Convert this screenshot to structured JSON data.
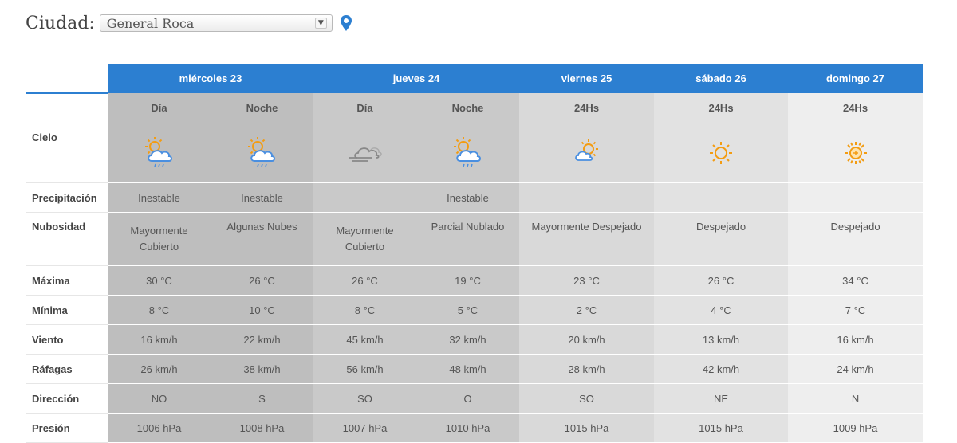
{
  "city": {
    "label": "Ciudad:",
    "selected": "General Roca"
  },
  "days": [
    {
      "label": "miércoles 23"
    },
    {
      "label": "jueves 24"
    },
    {
      "label": "viernes 25"
    },
    {
      "label": "sábado 26"
    },
    {
      "label": "domingo 27"
    }
  ],
  "periods": [
    "Día",
    "Noche",
    "Día",
    "Noche",
    "24Hs",
    "24Hs",
    "24Hs"
  ],
  "rows": {
    "cielo": "Cielo",
    "precipitacion": "Precipitación",
    "nubosidad": "Nubosidad",
    "maxima": "Máxima",
    "minima": "Mínima",
    "viento": "Viento",
    "rafagas": "Ráfagas",
    "direccion": "Dirección",
    "presion": "Presión"
  },
  "sky_icons": [
    "sun-cloud-rain-icon",
    "sun-cloud-rain-icon",
    "cloud-wind-icon",
    "sun-cloud-rain-icon",
    "sun-cloud-icon",
    "sun-icon",
    "hot-sun-icon"
  ],
  "precipitacion": [
    "Inestable",
    "Inestable",
    "",
    "Inestable",
    "",
    "",
    ""
  ],
  "nubosidad": [
    [
      "Mayormente",
      "Cubierto"
    ],
    [
      "Algunas Nubes",
      ""
    ],
    [
      "Mayormente",
      "Cubierto"
    ],
    [
      "Parcial Nublado",
      ""
    ],
    [
      "Mayormente Despejado",
      ""
    ],
    [
      "Despejado",
      ""
    ],
    [
      "Despejado",
      ""
    ]
  ],
  "maxima": [
    "30 °C",
    "26 °C",
    "26 °C",
    "19 °C",
    "23 °C",
    "26 °C",
    "34 °C"
  ],
  "minima": [
    "8 °C",
    "10 °C",
    "8 °C",
    "5 °C",
    "2 °C",
    "4 °C",
    "7 °C"
  ],
  "viento": [
    "16 km/h",
    "22 km/h",
    "45 km/h",
    "32 km/h",
    "20 km/h",
    "13 km/h",
    "16 km/h"
  ],
  "rafagas": [
    "26 km/h",
    "38 km/h",
    "56 km/h",
    "48 km/h",
    "28 km/h",
    "42 km/h",
    "24 km/h"
  ],
  "direccion": [
    "NO",
    "S",
    "SO",
    "O",
    "SO",
    "NE",
    "N"
  ],
  "presion": [
    "1006 hPa",
    "1008 hPa",
    "1007 hPa",
    "1010 hPa",
    "1015 hPa",
    "1015 hPa",
    "1009 hPa"
  ],
  "colors": {
    "header_blue": "#2c7fd1",
    "sun_orange": "#f39c12",
    "cloud_blue": "#4a8fe0",
    "cloud_gray": "#888888"
  }
}
